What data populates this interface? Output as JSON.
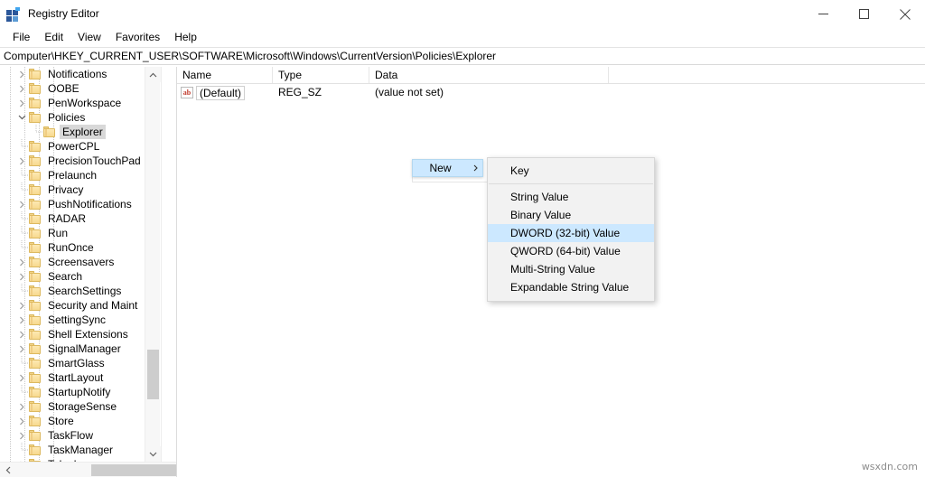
{
  "window": {
    "title": "Registry Editor",
    "icon": "registry-icon",
    "controls": {
      "minimize": "minimize-icon",
      "maximize": "maximize-icon",
      "close": "close-icon"
    }
  },
  "menubar": {
    "items": [
      {
        "label": "File"
      },
      {
        "label": "Edit"
      },
      {
        "label": "View"
      },
      {
        "label": "Favorites"
      },
      {
        "label": "Help"
      }
    ]
  },
  "address": {
    "path": "Computer\\HKEY_CURRENT_USER\\SOFTWARE\\Microsoft\\Windows\\CurrentVersion\\Policies\\Explorer"
  },
  "tree": {
    "items": [
      {
        "label": "Notifications",
        "indent": 2,
        "expandable": true,
        "expanded": false,
        "selected": false
      },
      {
        "label": "OOBE",
        "indent": 2,
        "expandable": true,
        "expanded": false,
        "selected": false
      },
      {
        "label": "PenWorkspace",
        "indent": 2,
        "expandable": true,
        "expanded": false,
        "selected": false
      },
      {
        "label": "Policies",
        "indent": 2,
        "expandable": true,
        "expanded": true,
        "selected": false
      },
      {
        "label": "Explorer",
        "indent": 3,
        "expandable": false,
        "expanded": false,
        "selected": true
      },
      {
        "label": "PowerCPL",
        "indent": 2,
        "expandable": false,
        "expanded": false,
        "selected": false
      },
      {
        "label": "PrecisionTouchPad",
        "indent": 2,
        "expandable": true,
        "expanded": false,
        "selected": false
      },
      {
        "label": "Prelaunch",
        "indent": 2,
        "expandable": false,
        "expanded": false,
        "selected": false
      },
      {
        "label": "Privacy",
        "indent": 2,
        "expandable": false,
        "expanded": false,
        "selected": false
      },
      {
        "label": "PushNotifications",
        "indent": 2,
        "expandable": true,
        "expanded": false,
        "selected": false
      },
      {
        "label": "RADAR",
        "indent": 2,
        "expandable": false,
        "expanded": false,
        "selected": false
      },
      {
        "label": "Run",
        "indent": 2,
        "expandable": false,
        "expanded": false,
        "selected": false
      },
      {
        "label": "RunOnce",
        "indent": 2,
        "expandable": false,
        "expanded": false,
        "selected": false
      },
      {
        "label": "Screensavers",
        "indent": 2,
        "expandable": true,
        "expanded": false,
        "selected": false
      },
      {
        "label": "Search",
        "indent": 2,
        "expandable": true,
        "expanded": false,
        "selected": false
      },
      {
        "label": "SearchSettings",
        "indent": 2,
        "expandable": false,
        "expanded": false,
        "selected": false
      },
      {
        "label": "Security and Maint",
        "indent": 2,
        "expandable": true,
        "expanded": false,
        "selected": false
      },
      {
        "label": "SettingSync",
        "indent": 2,
        "expandable": true,
        "expanded": false,
        "selected": false
      },
      {
        "label": "Shell Extensions",
        "indent": 2,
        "expandable": true,
        "expanded": false,
        "selected": false
      },
      {
        "label": "SignalManager",
        "indent": 2,
        "expandable": true,
        "expanded": false,
        "selected": false
      },
      {
        "label": "SmartGlass",
        "indent": 2,
        "expandable": false,
        "expanded": false,
        "selected": false
      },
      {
        "label": "StartLayout",
        "indent": 2,
        "expandable": true,
        "expanded": false,
        "selected": false
      },
      {
        "label": "StartupNotify",
        "indent": 2,
        "expandable": false,
        "expanded": false,
        "selected": false
      },
      {
        "label": "StorageSense",
        "indent": 2,
        "expandable": true,
        "expanded": false,
        "selected": false
      },
      {
        "label": "Store",
        "indent": 2,
        "expandable": true,
        "expanded": false,
        "selected": false
      },
      {
        "label": "TaskFlow",
        "indent": 2,
        "expandable": true,
        "expanded": false,
        "selected": false
      },
      {
        "label": "TaskManager",
        "indent": 2,
        "expandable": false,
        "expanded": false,
        "selected": false
      },
      {
        "label": "Telephony",
        "indent": 2,
        "expandable": true,
        "expanded": false,
        "selected": false
      }
    ]
  },
  "list": {
    "columns": [
      {
        "label": "Name"
      },
      {
        "label": "Type"
      },
      {
        "label": "Data"
      }
    ],
    "rows": [
      {
        "name": "(Default)",
        "type": "REG_SZ",
        "data": "(value not set)",
        "icon": "ab-string-icon"
      }
    ]
  },
  "context_menu": {
    "parent_item": "New",
    "submenu": [
      {
        "label": "Key",
        "highlighted": false,
        "separator_after": true
      },
      {
        "label": "String Value",
        "highlighted": false,
        "separator_after": false
      },
      {
        "label": "Binary Value",
        "highlighted": false,
        "separator_after": false
      },
      {
        "label": "DWORD (32-bit) Value",
        "highlighted": true,
        "separator_after": false
      },
      {
        "label": "QWORD (64-bit) Value",
        "highlighted": false,
        "separator_after": false
      },
      {
        "label": "Multi-String Value",
        "highlighted": false,
        "separator_after": false
      },
      {
        "label": "Expandable String Value",
        "highlighted": false,
        "separator_after": false
      }
    ]
  },
  "watermark": {
    "text": "wsxdn.com"
  },
  "colors": {
    "highlight": "#cce8ff",
    "selection_gray": "#d8d8d8",
    "folder": "#f7d98f",
    "accent": "#2b579a"
  }
}
